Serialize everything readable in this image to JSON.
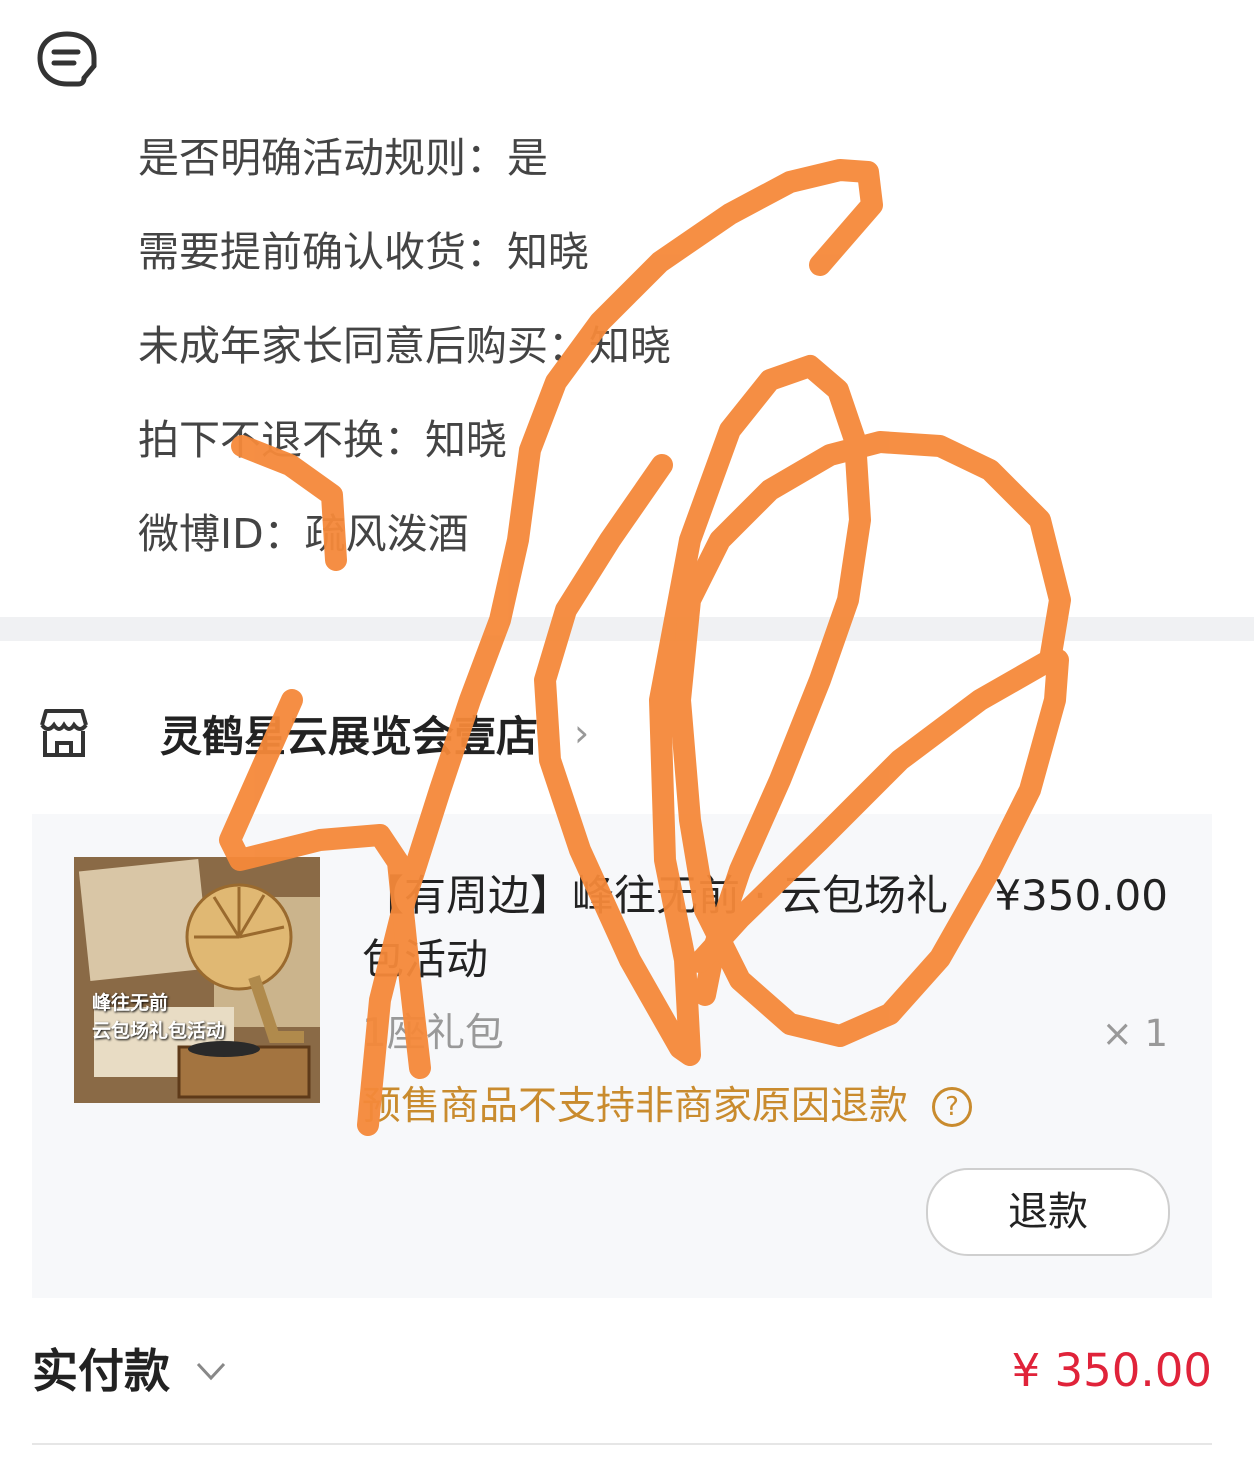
{
  "info": {
    "rows": [
      "是否明确活动规则：是",
      "需要提前确认收货：知晓",
      "未成年家长同意后购买：知晓",
      "拍下不退不换：知晓",
      "微博ID：疏风泼酒"
    ]
  },
  "shop": {
    "name": "灵鹤星云展览会壹店",
    "chevron": "›"
  },
  "item": {
    "thumbnail_text": "峰往无前\n云包场礼包活动",
    "title": "【有周边】峰往无前 · 云包场礼包活动",
    "price": "¥350.00",
    "spec": "1座礼包",
    "quantity": "× 1",
    "refund_note": "预售商品不支持非商家原因退款",
    "help_icon": "?",
    "refund_button": "退款"
  },
  "payment": {
    "label": "实付款",
    "amount": "¥ 350.00"
  },
  "colors": {
    "scribble": "#f5893a",
    "note": "#c98b2e",
    "price_red": "#e0233a"
  }
}
